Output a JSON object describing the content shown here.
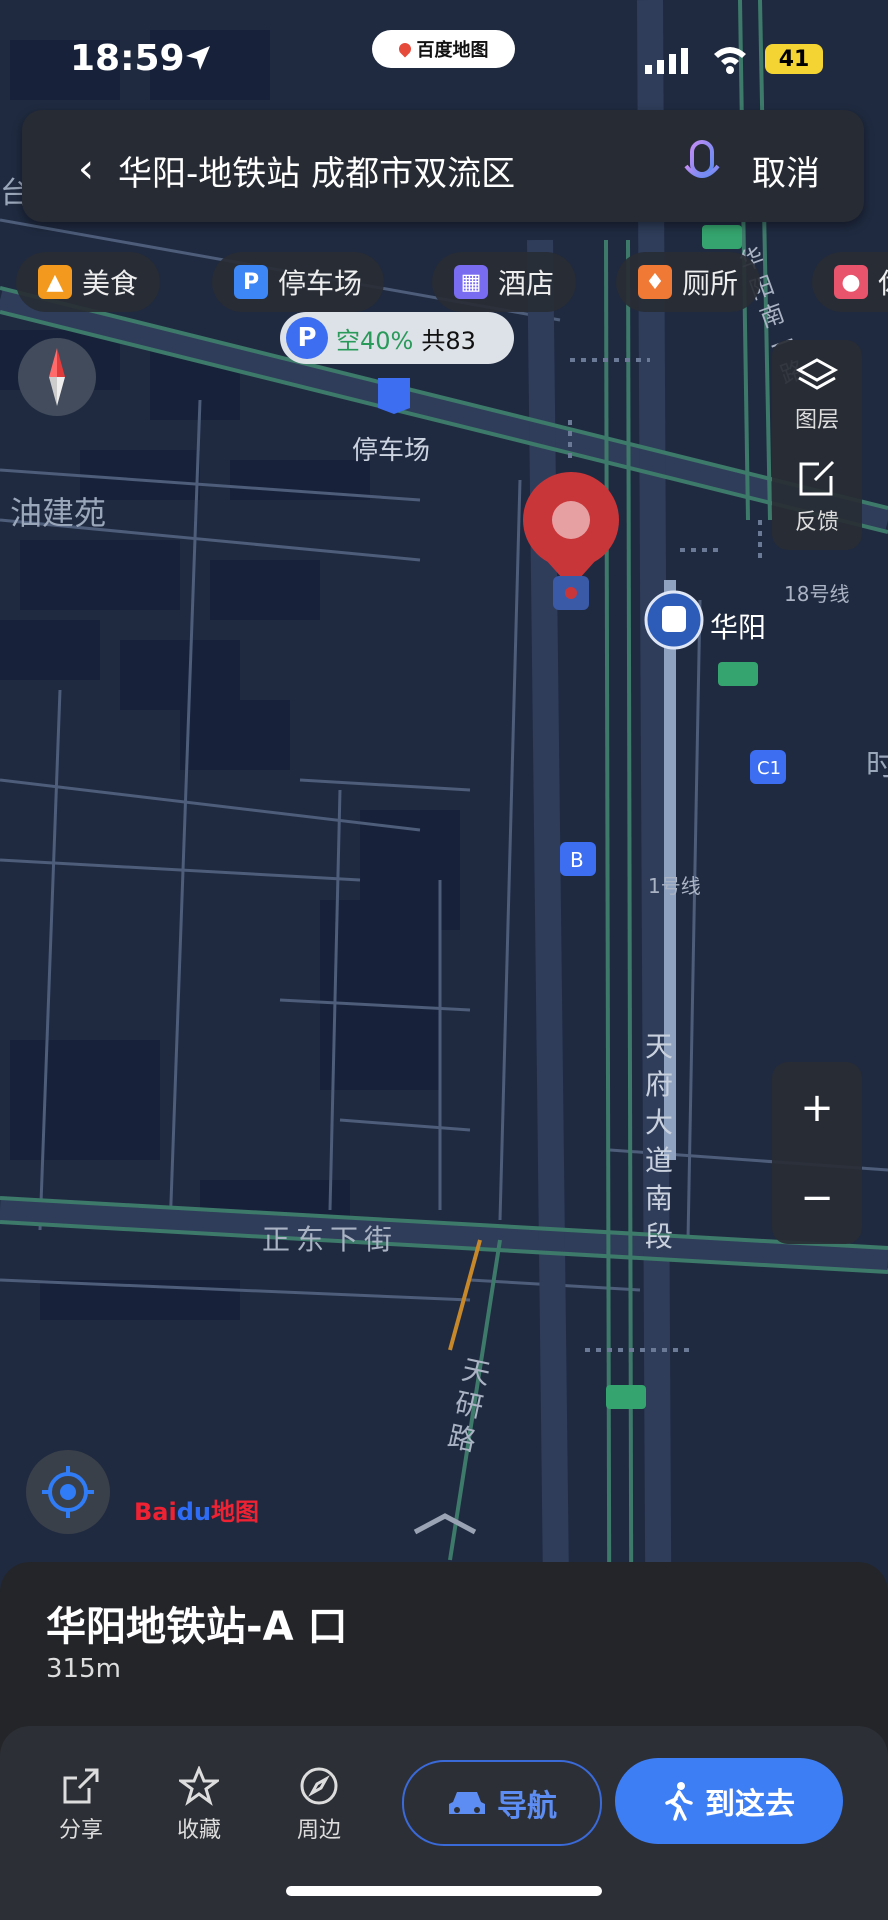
{
  "status": {
    "time": "18:59",
    "app_name": "百度地图",
    "battery": "41"
  },
  "search": {
    "back": "‹",
    "query": "华阳-地铁站 成都市双流区",
    "cancel": "取消"
  },
  "chips": [
    {
      "label": "美食",
      "icon": "food-icon",
      "color": "#f39a1e"
    },
    {
      "label": "停车场",
      "icon": "parking-icon",
      "color": "#3d86f5"
    },
    {
      "label": "酒店",
      "icon": "hotel-icon",
      "color": "#7a6cf0"
    },
    {
      "label": "厕所",
      "icon": "toilet-icon",
      "color": "#f07a35"
    },
    {
      "label": "休",
      "icon": "leisure-icon",
      "color": "#e8546b"
    }
  ],
  "parking_info": {
    "symbol": "P",
    "availability": "空40%",
    "total": "共83"
  },
  "map_labels": {
    "parking": "停车场",
    "youjianyuan": "油建苑",
    "huayang": "华阳",
    "line18": "18号线",
    "exit_c1": "C1",
    "exit_b": "B",
    "line1": "1号线",
    "road_south": "天府大道南段",
    "road_east": "正东下街",
    "road_tianyan": "天研路",
    "road_huayang_south": "华阳南一路",
    "edge_right": "时",
    "edge_left": "台"
  },
  "side_panel": {
    "layers": "图层",
    "feedback": "反馈"
  },
  "zoom": {
    "in": "+",
    "out": "−"
  },
  "logo": {
    "brand_a": "Bai",
    "brand_b": "du",
    "brand_c": "地图"
  },
  "place": {
    "title": "华阳地铁站-A 口",
    "distance": "315m"
  },
  "actions": {
    "share": "分享",
    "favorite": "收藏",
    "nearby": "周边",
    "navigate": "导航",
    "go_here": "到这去"
  },
  "colors": {
    "accent": "#3e7ef5",
    "map_bg": "#1f2a40",
    "marker": "#c9363a"
  }
}
